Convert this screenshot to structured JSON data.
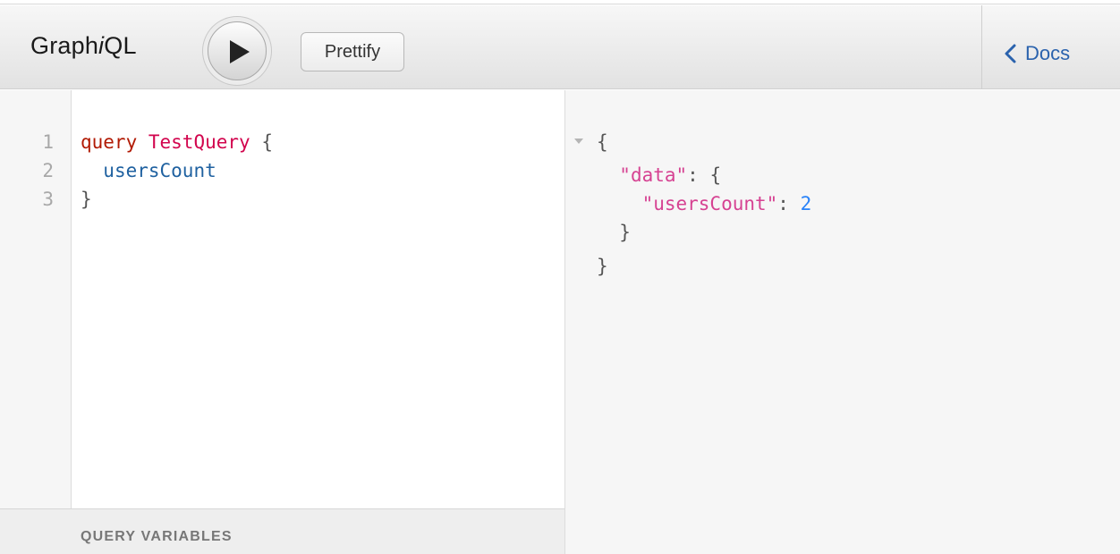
{
  "header": {
    "title_prefix": "Graph",
    "title_italic": "i",
    "title_suffix": "QL",
    "execute_icon": "play-icon",
    "prettify_label": "Prettify",
    "docs_label": "Docs",
    "docs_icon": "chevron-left-icon"
  },
  "query_editor": {
    "line_numbers": [
      "1",
      "2",
      "3"
    ],
    "line1": {
      "keyword": "query",
      "name": "TestQuery",
      "brace": "{"
    },
    "line2": {
      "field": "usersCount"
    },
    "line3": {
      "brace": "}"
    }
  },
  "variables_panel": {
    "label": "QUERY VARIABLES"
  },
  "result_viewer": {
    "line1": "{",
    "line2": {
      "key": "\"data\"",
      "rest": ": {"
    },
    "line3": {
      "key": "\"usersCount\"",
      "colon": ": ",
      "value": "2"
    },
    "line4": "}",
    "line5": "}"
  },
  "colors": {
    "keyword": "#b11a04",
    "def": "#d2054e",
    "field": "#1f61a0",
    "string": "#d64292",
    "number": "#2882f9",
    "link": "#2a62ad"
  }
}
